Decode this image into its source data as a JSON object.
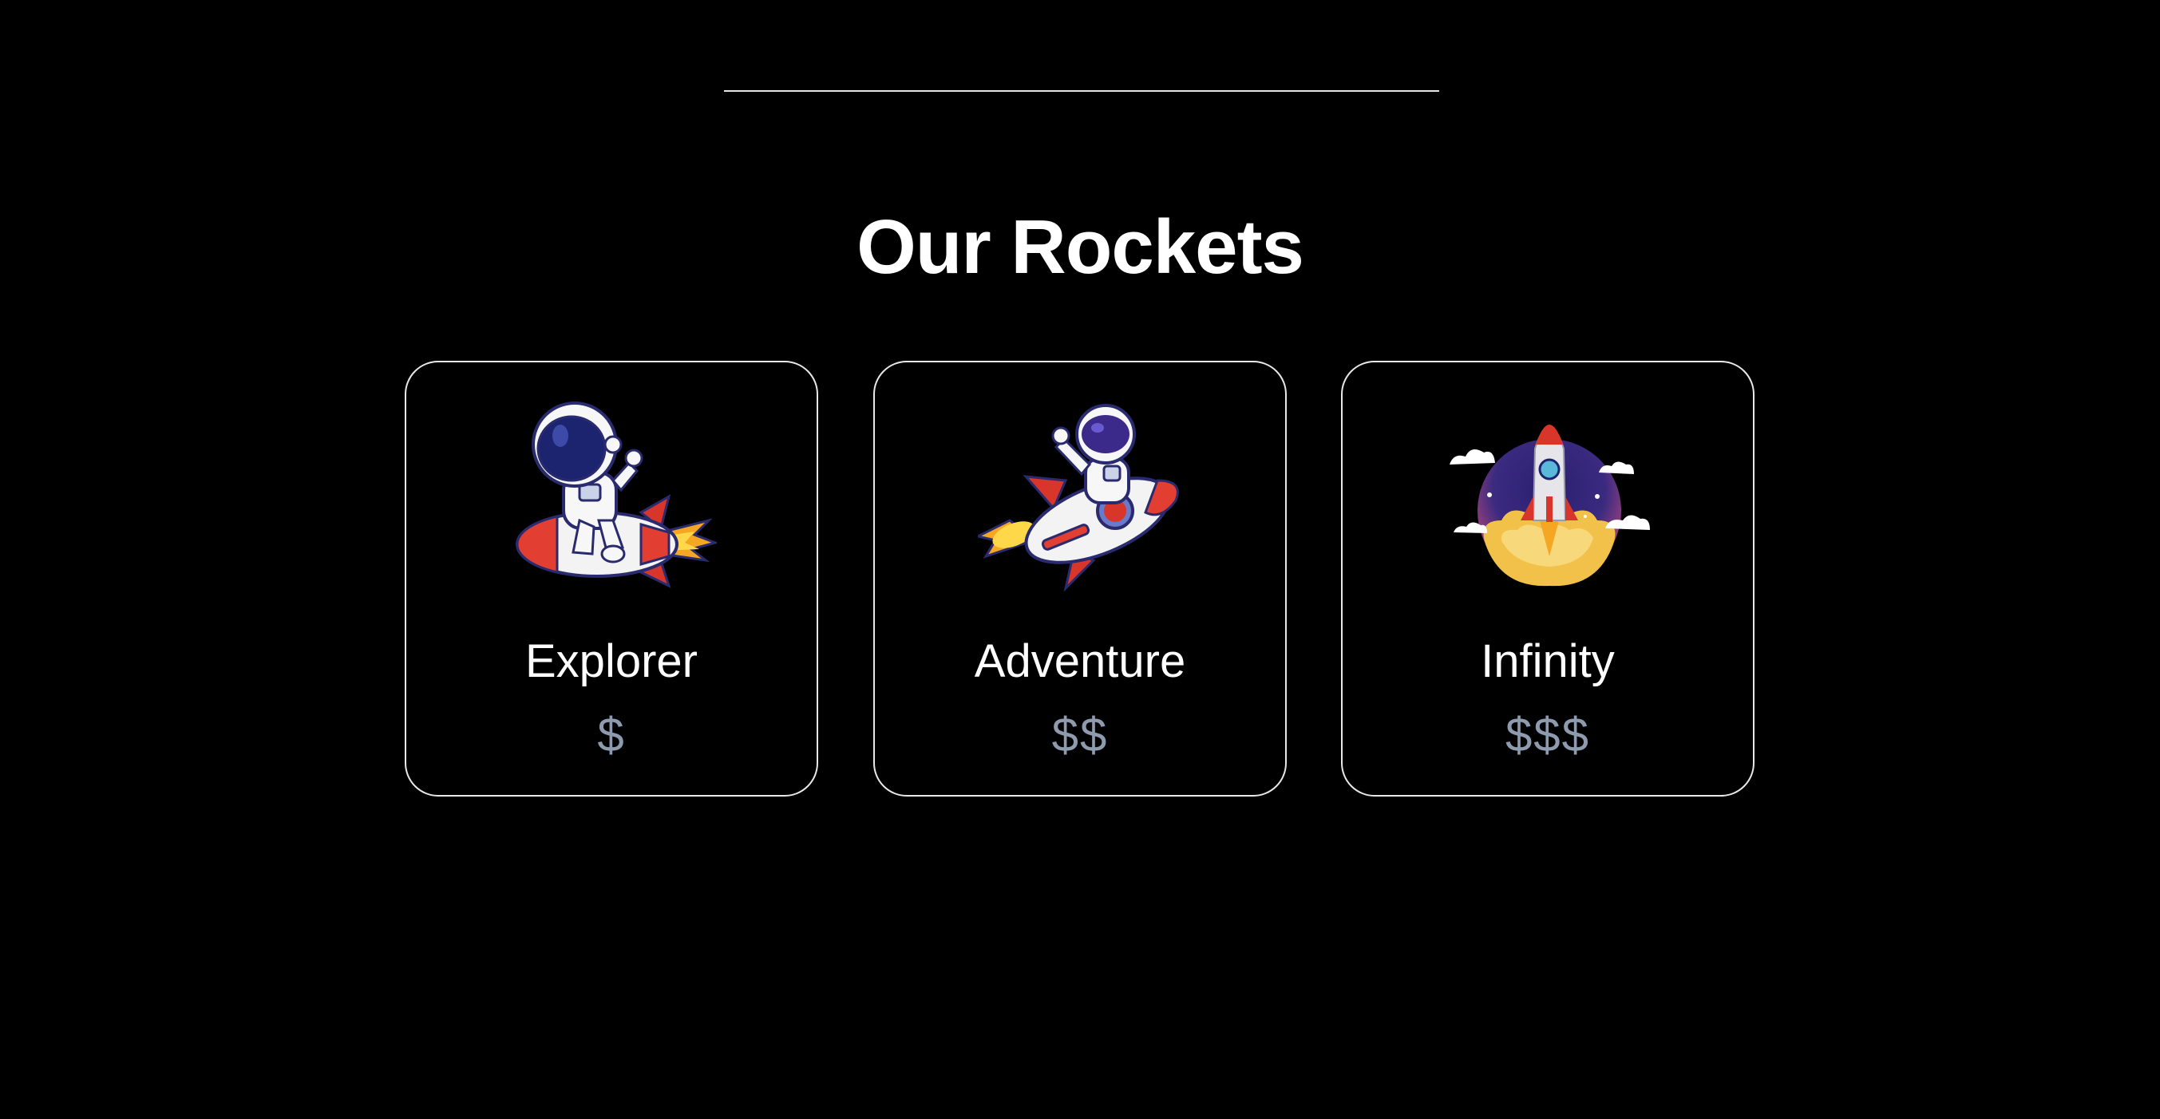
{
  "section": {
    "title": "Our Rockets"
  },
  "rockets": [
    {
      "name": "Explorer",
      "price": "$",
      "icon": "astronaut-riding-rocket-icon"
    },
    {
      "name": "Adventure",
      "price": "$$",
      "icon": "astronaut-waving-on-rocket-icon"
    },
    {
      "name": "Infinity",
      "price": "$$$",
      "icon": "rocket-launch-icon"
    }
  ],
  "colors": {
    "background": "#000000",
    "text": "#ffffff",
    "price": "#8e9aae",
    "card_border": "#e8e8e8"
  }
}
